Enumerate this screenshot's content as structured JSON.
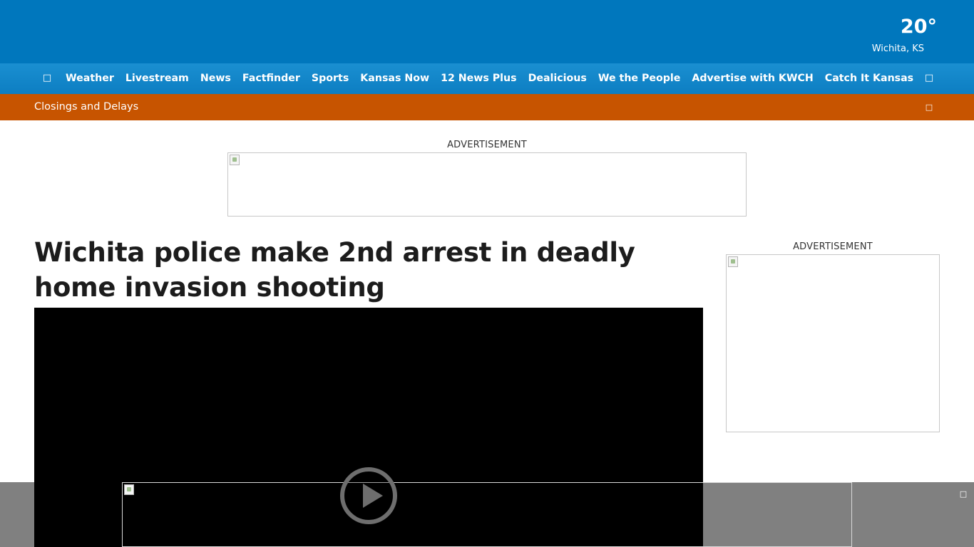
{
  "header": {
    "weather": {
      "temperature": "20°",
      "location": "Wichita, KS"
    }
  },
  "nav": {
    "home_icon": "home-icon",
    "items": [
      {
        "label": "Weather"
      },
      {
        "label": "Livestream"
      },
      {
        "label": "News"
      },
      {
        "label": "Factfinder"
      },
      {
        "label": "Sports"
      },
      {
        "label": "Kansas Now"
      },
      {
        "label": "12 News Plus"
      },
      {
        "label": "Dealicious"
      },
      {
        "label": "We the People"
      },
      {
        "label": "Advertise with KWCH"
      },
      {
        "label": "Catch It Kansas"
      }
    ],
    "menu_icon": "menu-icon"
  },
  "alert_bar": {
    "text": "Closings and Delays",
    "close_icon": "close-icon"
  },
  "ads": {
    "top_label": "ADVERTISEMENT",
    "sidebar_label": "ADVERTISEMENT"
  },
  "article": {
    "headline": "Wichita police make 2nd arrest in deadly home invasion shooting"
  },
  "video": {
    "play_icon": "play-icon"
  },
  "sticky_ad": {
    "close_icon": "close-icon"
  },
  "colors": {
    "header_blue": "#0077bd",
    "nav_blue": "#1a8fd1",
    "alert_orange": "#c75400",
    "sticky_gray": "#808080"
  }
}
